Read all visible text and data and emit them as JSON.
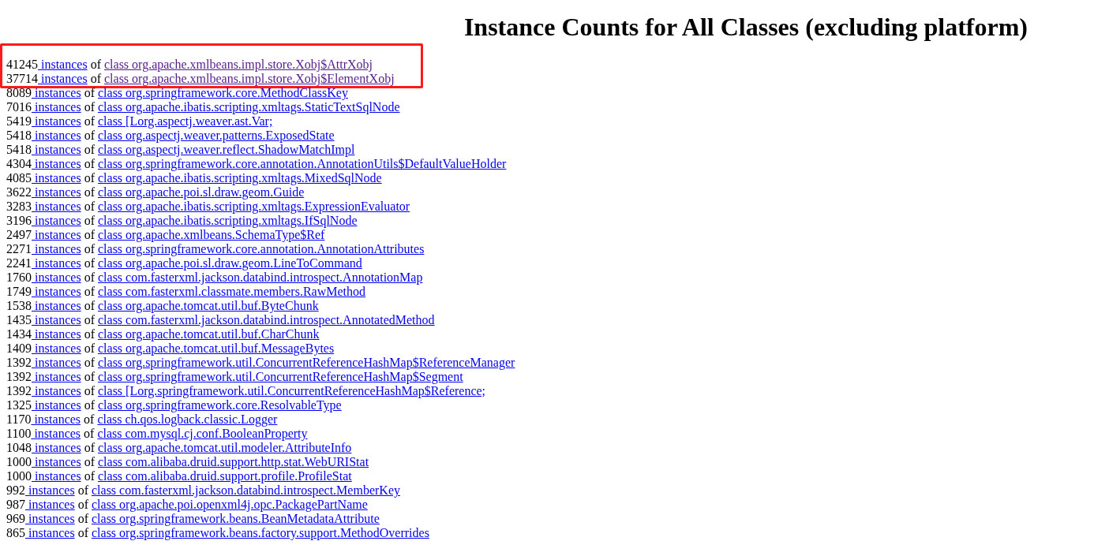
{
  "title": "Instance Counts for All Classes (excluding platform)",
  "rows": [
    {
      "count": "41245",
      "link": "instances",
      "joiner": "of",
      "class_name": "class org.apache.xmlbeans.impl.store.Xobj$AttrXobj",
      "visited": true,
      "highlighted": true
    },
    {
      "count": "37714",
      "link": "instances",
      "joiner": "of",
      "class_name": "class org.apache.xmlbeans.impl.store.Xobj$ElementXobj",
      "visited": true,
      "highlighted": true
    },
    {
      "count": "8089",
      "link": "instances",
      "joiner": "of",
      "class_name": "class org.springframework.core.MethodClassKey",
      "visited": false,
      "highlighted": false
    },
    {
      "count": "7016",
      "link": "instances",
      "joiner": "of",
      "class_name": "class org.apache.ibatis.scripting.xmltags.StaticTextSqlNode",
      "visited": false,
      "highlighted": false
    },
    {
      "count": "5419",
      "link": "instances",
      "joiner": "of",
      "class_name": "class [Lorg.aspectj.weaver.ast.Var;",
      "visited": false,
      "highlighted": false
    },
    {
      "count": "5418",
      "link": "instances",
      "joiner": "of",
      "class_name": "class org.aspectj.weaver.patterns.ExposedState",
      "visited": false,
      "highlighted": false
    },
    {
      "count": "5418",
      "link": "instances",
      "joiner": "of",
      "class_name": "class org.aspectj.weaver.reflect.ShadowMatchImpl",
      "visited": false,
      "highlighted": false
    },
    {
      "count": "4304",
      "link": "instances",
      "joiner": "of",
      "class_name": "class org.springframework.core.annotation.AnnotationUtils$DefaultValueHolder",
      "visited": false,
      "highlighted": false
    },
    {
      "count": "4085",
      "link": "instances",
      "joiner": "of",
      "class_name": "class org.apache.ibatis.scripting.xmltags.MixedSqlNode",
      "visited": false,
      "highlighted": false
    },
    {
      "count": "3622",
      "link": "instances",
      "joiner": "of",
      "class_name": "class org.apache.poi.sl.draw.geom.Guide",
      "visited": false,
      "highlighted": false
    },
    {
      "count": "3283",
      "link": "instances",
      "joiner": "of",
      "class_name": "class org.apache.ibatis.scripting.xmltags.ExpressionEvaluator",
      "visited": false,
      "highlighted": false
    },
    {
      "count": "3196",
      "link": "instances",
      "joiner": "of",
      "class_name": "class org.apache.ibatis.scripting.xmltags.IfSqlNode",
      "visited": false,
      "highlighted": false
    },
    {
      "count": "2497",
      "link": "instances",
      "joiner": "of",
      "class_name": "class org.apache.xmlbeans.SchemaType$Ref",
      "visited": false,
      "highlighted": false
    },
    {
      "count": "2271",
      "link": "instances",
      "joiner": "of",
      "class_name": "class org.springframework.core.annotation.AnnotationAttributes",
      "visited": false,
      "highlighted": false
    },
    {
      "count": "2241",
      "link": "instances",
      "joiner": "of",
      "class_name": "class org.apache.poi.sl.draw.geom.LineToCommand",
      "visited": false,
      "highlighted": false
    },
    {
      "count": "1760",
      "link": "instances",
      "joiner": "of",
      "class_name": "class com.fasterxml.jackson.databind.introspect.AnnotationMap",
      "visited": false,
      "highlighted": false
    },
    {
      "count": "1749",
      "link": "instances",
      "joiner": "of",
      "class_name": "class com.fasterxml.classmate.members.RawMethod",
      "visited": false,
      "highlighted": false
    },
    {
      "count": "1538",
      "link": "instances",
      "joiner": "of",
      "class_name": "class org.apache.tomcat.util.buf.ByteChunk",
      "visited": false,
      "highlighted": false
    },
    {
      "count": "1435",
      "link": "instances",
      "joiner": "of",
      "class_name": "class com.fasterxml.jackson.databind.introspect.AnnotatedMethod",
      "visited": false,
      "highlighted": false
    },
    {
      "count": "1434",
      "link": "instances",
      "joiner": "of",
      "class_name": "class org.apache.tomcat.util.buf.CharChunk",
      "visited": false,
      "highlighted": false
    },
    {
      "count": "1409",
      "link": "instances",
      "joiner": "of",
      "class_name": "class org.apache.tomcat.util.buf.MessageBytes",
      "visited": false,
      "highlighted": false
    },
    {
      "count": "1392",
      "link": "instances",
      "joiner": "of",
      "class_name": "class org.springframework.util.ConcurrentReferenceHashMap$ReferenceManager",
      "visited": false,
      "highlighted": false
    },
    {
      "count": "1392",
      "link": "instances",
      "joiner": "of",
      "class_name": "class org.springframework.util.ConcurrentReferenceHashMap$Segment",
      "visited": false,
      "highlighted": false
    },
    {
      "count": "1392",
      "link": "instances",
      "joiner": "of",
      "class_name": "class [Lorg.springframework.util.ConcurrentReferenceHashMap$Reference;",
      "visited": false,
      "highlighted": false
    },
    {
      "count": "1325",
      "link": "instances",
      "joiner": "of",
      "class_name": "class org.springframework.core.ResolvableType",
      "visited": false,
      "highlighted": false
    },
    {
      "count": "1170",
      "link": "instances",
      "joiner": "of",
      "class_name": "class ch.qos.logback.classic.Logger",
      "visited": false,
      "highlighted": false
    },
    {
      "count": "1100",
      "link": "instances",
      "joiner": "of",
      "class_name": "class com.mysql.cj.conf.BooleanProperty",
      "visited": false,
      "highlighted": false
    },
    {
      "count": "1048",
      "link": "instances",
      "joiner": "of",
      "class_name": "class org.apache.tomcat.util.modeler.AttributeInfo",
      "visited": false,
      "highlighted": false
    },
    {
      "count": "1000",
      "link": "instances",
      "joiner": "of",
      "class_name": "class com.alibaba.druid.support.http.stat.WebURIStat",
      "visited": false,
      "highlighted": false
    },
    {
      "count": "1000",
      "link": "instances",
      "joiner": "of",
      "class_name": "class com.alibaba.druid.support.profile.ProfileStat",
      "visited": false,
      "highlighted": false
    },
    {
      "count": "992",
      "link": "instances",
      "joiner": "of",
      "class_name": "class com.fasterxml.jackson.databind.introspect.MemberKey",
      "visited": false,
      "highlighted": false
    },
    {
      "count": "987",
      "link": "instances",
      "joiner": "of",
      "class_name": "class org.apache.poi.openxml4j.opc.PackagePartName",
      "visited": false,
      "highlighted": false
    },
    {
      "count": "969",
      "link": "instances",
      "joiner": "of",
      "class_name": "class org.springframework.beans.BeanMetadataAttribute",
      "visited": false,
      "highlighted": false
    },
    {
      "count": "865",
      "link": "instances",
      "joiner": "of",
      "class_name": "class org.springframework.beans.factory.support.MethodOverrides",
      "visited": false,
      "highlighted": false
    }
  ]
}
